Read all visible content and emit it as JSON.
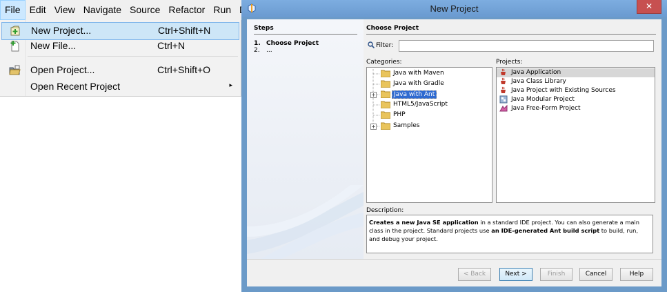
{
  "menubar": {
    "items": [
      "File",
      "Edit",
      "View",
      "Navigate",
      "Source",
      "Refactor",
      "Run",
      "De"
    ]
  },
  "file_menu": {
    "items": [
      {
        "label": "New Project...",
        "accel": "Ctrl+Shift+N",
        "icon": "new-project-icon",
        "highlighted": true
      },
      {
        "label": "New File...",
        "accel": "Ctrl+N",
        "icon": "new-file-icon"
      },
      {
        "label": "Open Project...",
        "accel": "Ctrl+Shift+O",
        "icon": "open-project-icon"
      },
      {
        "label": "Open Recent Project",
        "accel": "",
        "has_submenu": true,
        "submenu_arrow": "▸"
      }
    ]
  },
  "dialog": {
    "title": "New Project",
    "close_glyph": "✕",
    "steps": {
      "title": "Steps",
      "items": [
        {
          "num": "1.",
          "label": "Choose Project",
          "current": true
        },
        {
          "num": "2.",
          "label": "...",
          "current": false
        }
      ]
    },
    "section_title": "Choose Project",
    "filter": {
      "label": "Filter:",
      "value": ""
    },
    "categories": {
      "label": "Categories:",
      "items": [
        {
          "label": "Java with Maven",
          "expandable": false
        },
        {
          "label": "Java with Gradle",
          "expandable": false
        },
        {
          "label": "Java with Ant",
          "expandable": true,
          "selected": true
        },
        {
          "label": "HTML5/JavaScript",
          "expandable": false
        },
        {
          "label": "PHP",
          "expandable": false
        },
        {
          "label": "Samples",
          "expandable": true
        }
      ]
    },
    "projects": {
      "label": "Projects:",
      "items": [
        {
          "label": "Java Application",
          "selected": true,
          "icon": "java-cup-icon"
        },
        {
          "label": "Java Class Library",
          "icon": "java-cup-icon"
        },
        {
          "label": "Java Project with Existing Sources",
          "icon": "java-cup-icon"
        },
        {
          "label": "Java Modular Project",
          "icon": "module-icon"
        },
        {
          "label": "Java Free-Form Project",
          "icon": "freeform-icon"
        }
      ]
    },
    "description": {
      "label": "Description:",
      "bold1": "Creates a new Java SE application",
      "text1": " in a standard IDE project. You can also generate a main class in the project. Standard projects use ",
      "bold2": "an IDE-generated Ant build script",
      "text2": " to build, run, and debug your project."
    },
    "buttons": {
      "back": "< Back",
      "next": "Next >",
      "finish": "Finish",
      "cancel": "Cancel",
      "help": "Help"
    },
    "colors": {
      "accent": "#6b9ac8",
      "close": "#c75050",
      "selection": "#2f6ad0"
    }
  }
}
